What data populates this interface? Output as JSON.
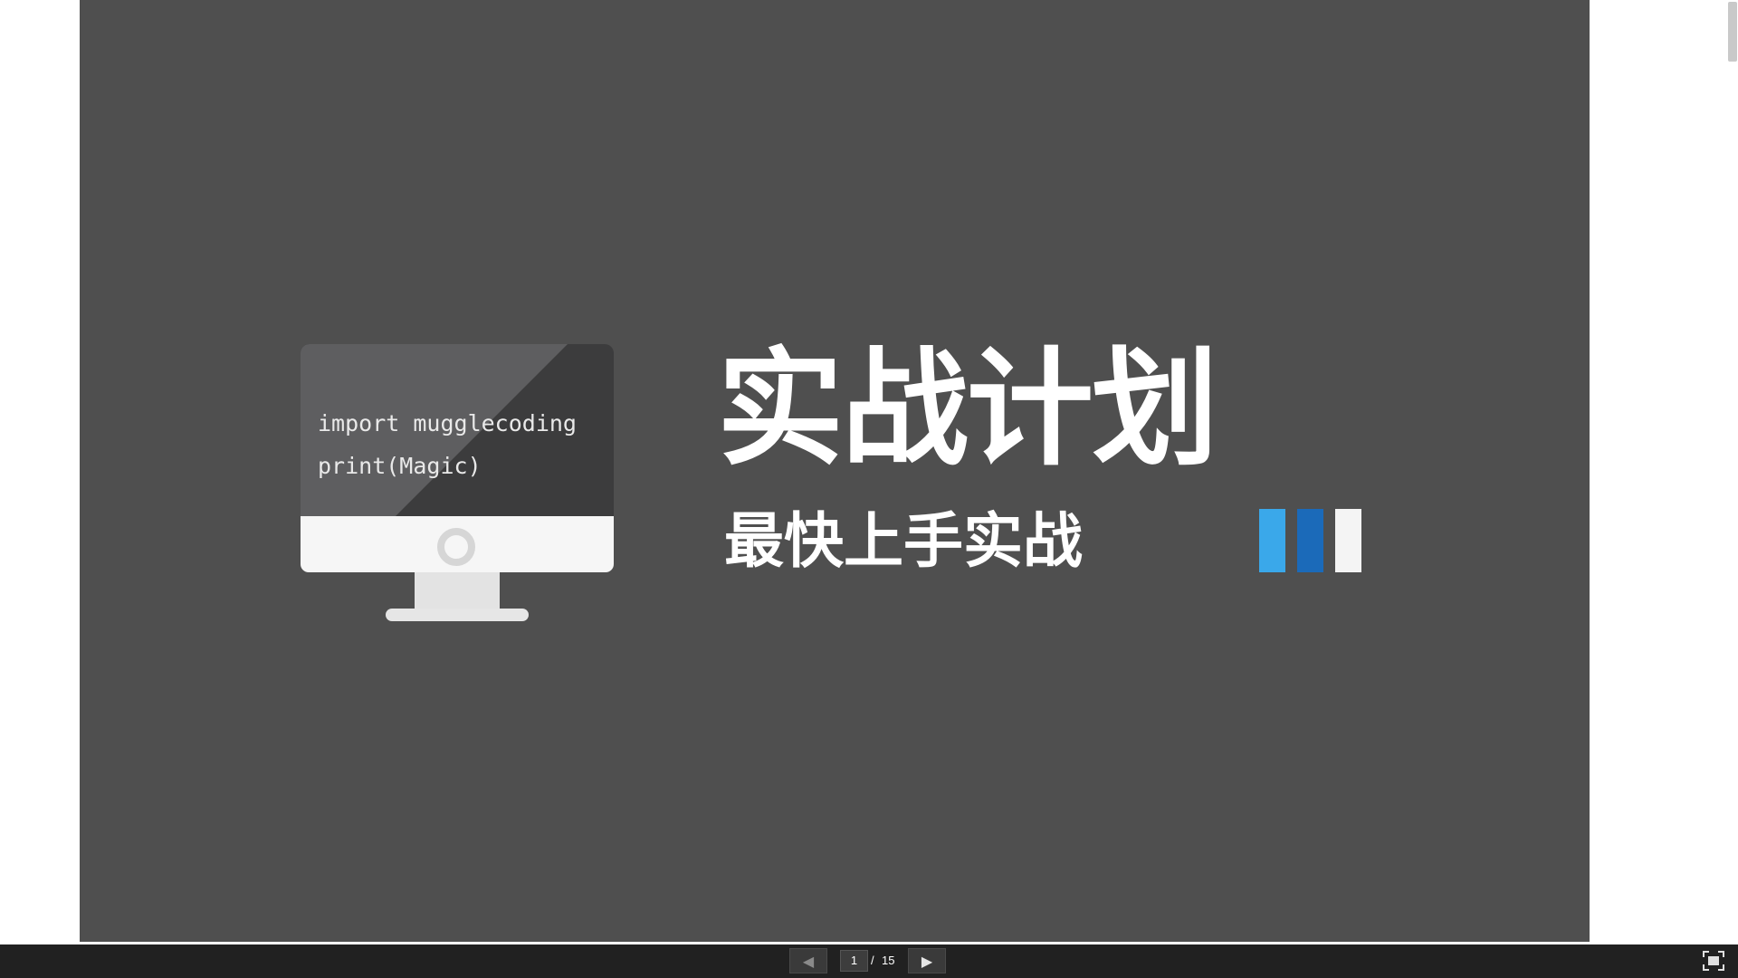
{
  "slide": {
    "code_lines": [
      "import mugglecoding",
      "print(Magic)"
    ],
    "title": "实战计划",
    "subtitle": "最快上手实战",
    "bar_colors": [
      "#3aa8ea",
      "#1b6ab9",
      "#f4f4f4"
    ],
    "background_color": "#4f4f4f"
  },
  "toolbar": {
    "prev_icon": "◀",
    "next_icon": "▶",
    "current_page": "1",
    "separator": "/",
    "total_pages": "15",
    "fullscreen_icon": "fullscreen-icon"
  }
}
